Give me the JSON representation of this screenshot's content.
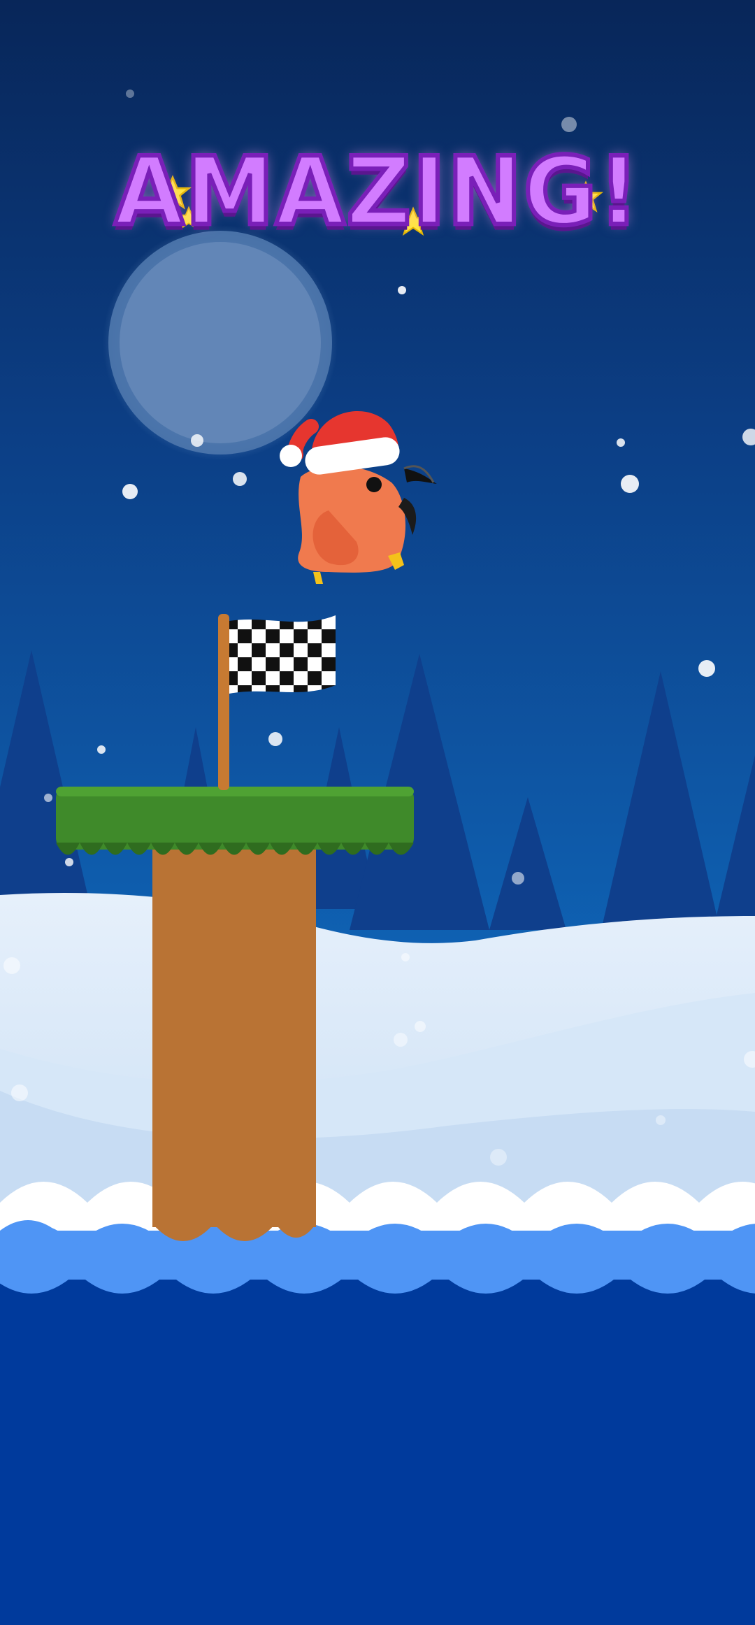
{
  "banner": {
    "text": "AMAZING!"
  },
  "icons": {
    "moon": "moon-icon",
    "star": "star-icon",
    "flag": "checkered-flag-icon",
    "player": "bird-with-santa-hat-icon"
  },
  "colors": {
    "sky_top": "#0a2a66",
    "sky_bottom": "#0e5aa6",
    "tree": "#0f3e8a",
    "snow": "#d9e9fb",
    "snow_shade": "#bcd6f0",
    "grass": "#3f8a2a",
    "grass_dark": "#2f6c1f",
    "pillar": "#b97334",
    "water_light": "#4f95f5",
    "water_deep": "#003a9c",
    "title_fill": "#d27cff",
    "title_stroke": "#7a1fb8",
    "star_yellow": "#ffe93a",
    "bird_body": "#f07a4e",
    "hat_red": "#e6362f"
  }
}
